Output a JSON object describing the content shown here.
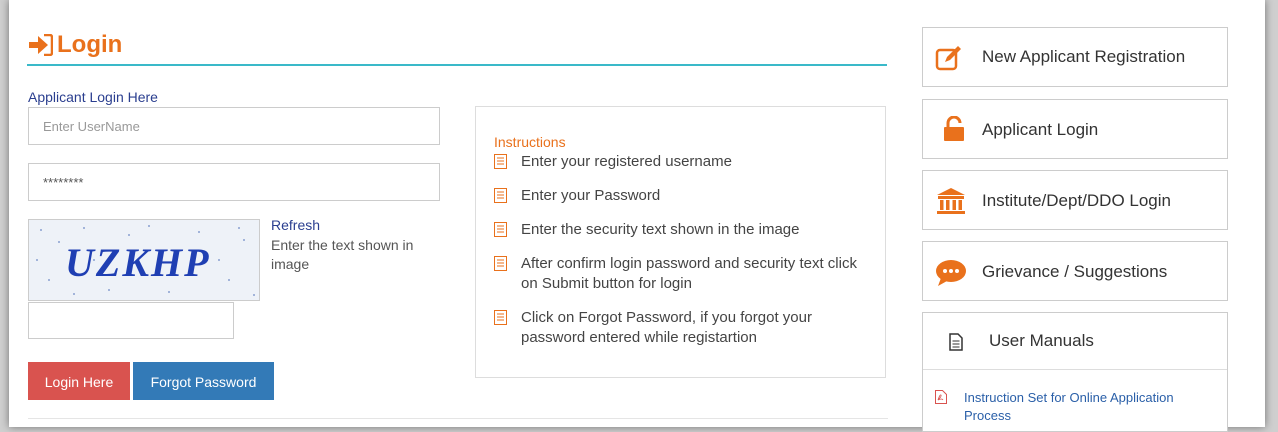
{
  "login": {
    "title": "Login",
    "subtitle": "Applicant Login Here",
    "username_placeholder": "Enter UserName",
    "password_value": "********",
    "captcha_text": "UZKHP",
    "refresh_label": "Refresh",
    "captcha_hint": "Enter the text shown in image",
    "login_button": "Login Here",
    "forgot_button": "Forgot Password"
  },
  "instructions": {
    "title": "Instructions",
    "items": [
      "Enter your registered username",
      "Enter your Password",
      "Enter the security text shown in the image",
      "After confirm login password and security text click on Submit button for login",
      "Click on Forgot Password, if you forgot your password entered while registartion"
    ],
    "icon": "list-doc-icon"
  },
  "side_menu": {
    "new_registration": "New Applicant Registration",
    "applicant_login": "Applicant Login",
    "institute_login": "Institute/Dept/DDO Login",
    "grievance": "Grievance / Suggestions",
    "user_manuals": "User Manuals",
    "manual_link": "Instruction Set for Online Application Process"
  },
  "colors": {
    "accent_orange": "#e9711c",
    "heading_rule": "#3ab9c9",
    "login_button": "#d9534f",
    "forgot_button": "#337ab7"
  }
}
